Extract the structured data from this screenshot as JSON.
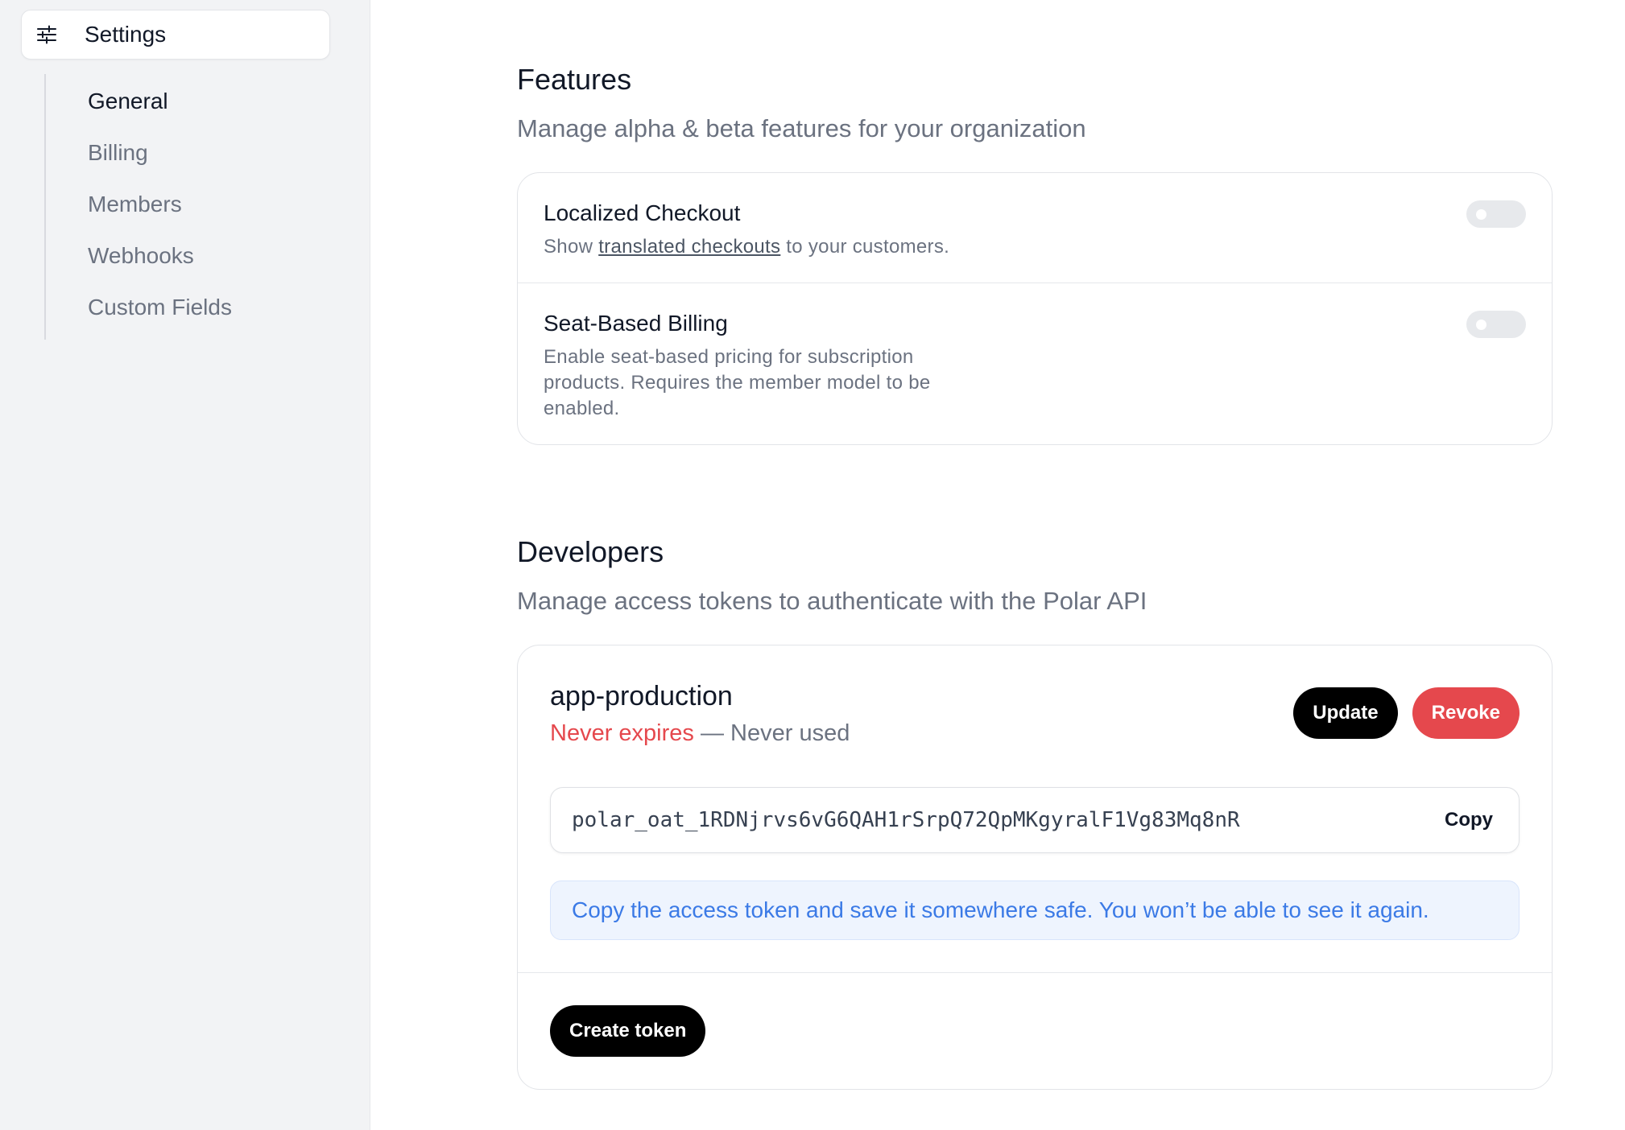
{
  "sidebar": {
    "header": {
      "label": "Settings",
      "icon": "sliders-icon"
    },
    "items": [
      {
        "label": "General",
        "active": true
      },
      {
        "label": "Billing",
        "active": false
      },
      {
        "label": "Members",
        "active": false
      },
      {
        "label": "Webhooks",
        "active": false
      },
      {
        "label": "Custom Fields",
        "active": false
      }
    ]
  },
  "features": {
    "title": "Features",
    "subtitle": "Manage alpha & beta features for your organization",
    "items": [
      {
        "title": "Localized Checkout",
        "desc_prefix": "Show ",
        "desc_link": "translated checkouts",
        "desc_suffix": " to your customers.",
        "enabled": false
      },
      {
        "title": "Seat-Based Billing",
        "desc": "Enable seat-based pricing for subscription products. Requires the member model to be enabled.",
        "enabled": false
      }
    ]
  },
  "developers": {
    "title": "Developers",
    "subtitle": "Manage access tokens to authenticate with the Polar API",
    "token": {
      "name": "app-production",
      "expires": "Never expires",
      "separator": " — ",
      "usage": "Never used",
      "value": "polar_oat_1RDNjrvs6vG6QAH1rSrpQ72QpMKgyralF1Vg83Mq8nR",
      "update_label": "Update",
      "revoke_label": "Revoke",
      "copy_label": "Copy",
      "notice": "Copy the access token and save it somewhere safe. You won’t be able to see it again."
    },
    "create_label": "Create token"
  },
  "colors": {
    "danger": "#e5484d",
    "notice_text": "#3b7ae6",
    "notice_bg": "#eef4fe",
    "sidebar_bg": "#f2f3f5"
  }
}
